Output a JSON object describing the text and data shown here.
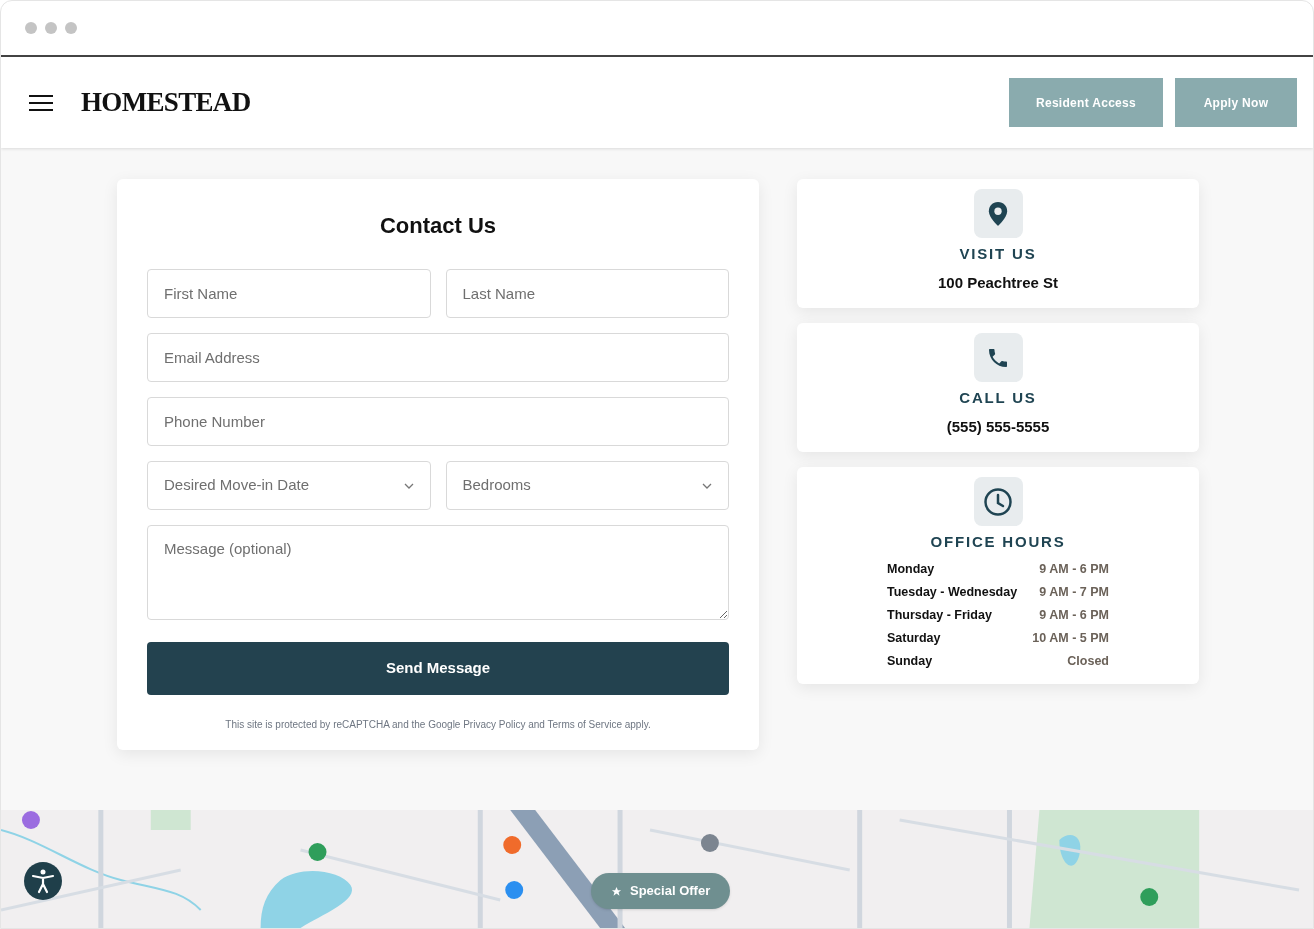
{
  "header": {
    "logo": "HOMESTEAD",
    "buttons": [
      "Resident Access",
      "Apply Now"
    ]
  },
  "form": {
    "title": "Contact Us",
    "rows": [
      {
        "fields": [
          {
            "kind": "text",
            "placeholder": "First Name"
          },
          {
            "kind": "text",
            "placeholder": "Last Name"
          }
        ]
      },
      {
        "fields": [
          {
            "kind": "text",
            "placeholder": "Email Address"
          }
        ]
      },
      {
        "fields": [
          {
            "kind": "text",
            "placeholder": "Phone Number"
          }
        ]
      },
      {
        "fields": [
          {
            "kind": "select",
            "placeholder": "Desired Move-in Date"
          },
          {
            "kind": "select",
            "placeholder": "Bedrooms"
          }
        ]
      },
      {
        "fields": [
          {
            "kind": "textarea",
            "placeholder": "Message (optional)"
          }
        ]
      }
    ],
    "submit": "Send Message",
    "notice": "This site is protected by reCAPTCHA and the Google Privacy Policy and Terms of Service apply."
  },
  "info_cards": [
    {
      "kind": "location",
      "title": "VISIT US",
      "text": "100 Peachtree St"
    },
    {
      "kind": "phone",
      "title": "CALL US",
      "text": "(555) 555-5555"
    },
    {
      "kind": "clock",
      "title": "OFFICE HOURS",
      "hours": [
        {
          "day": "Monday",
          "time": "9 AM - 6 PM"
        },
        {
          "day": "Tuesday - Wednesday",
          "time": "9 AM - 7 PM"
        },
        {
          "day": "Thursday - Friday",
          "time": "9 AM - 6 PM"
        },
        {
          "day": "Saturday",
          "time": "10 AM - 5 PM"
        },
        {
          "day": "Sunday",
          "time": "Closed"
        }
      ]
    }
  ],
  "map": {
    "kind": "picture",
    "special_offer": "Special Offer"
  }
}
